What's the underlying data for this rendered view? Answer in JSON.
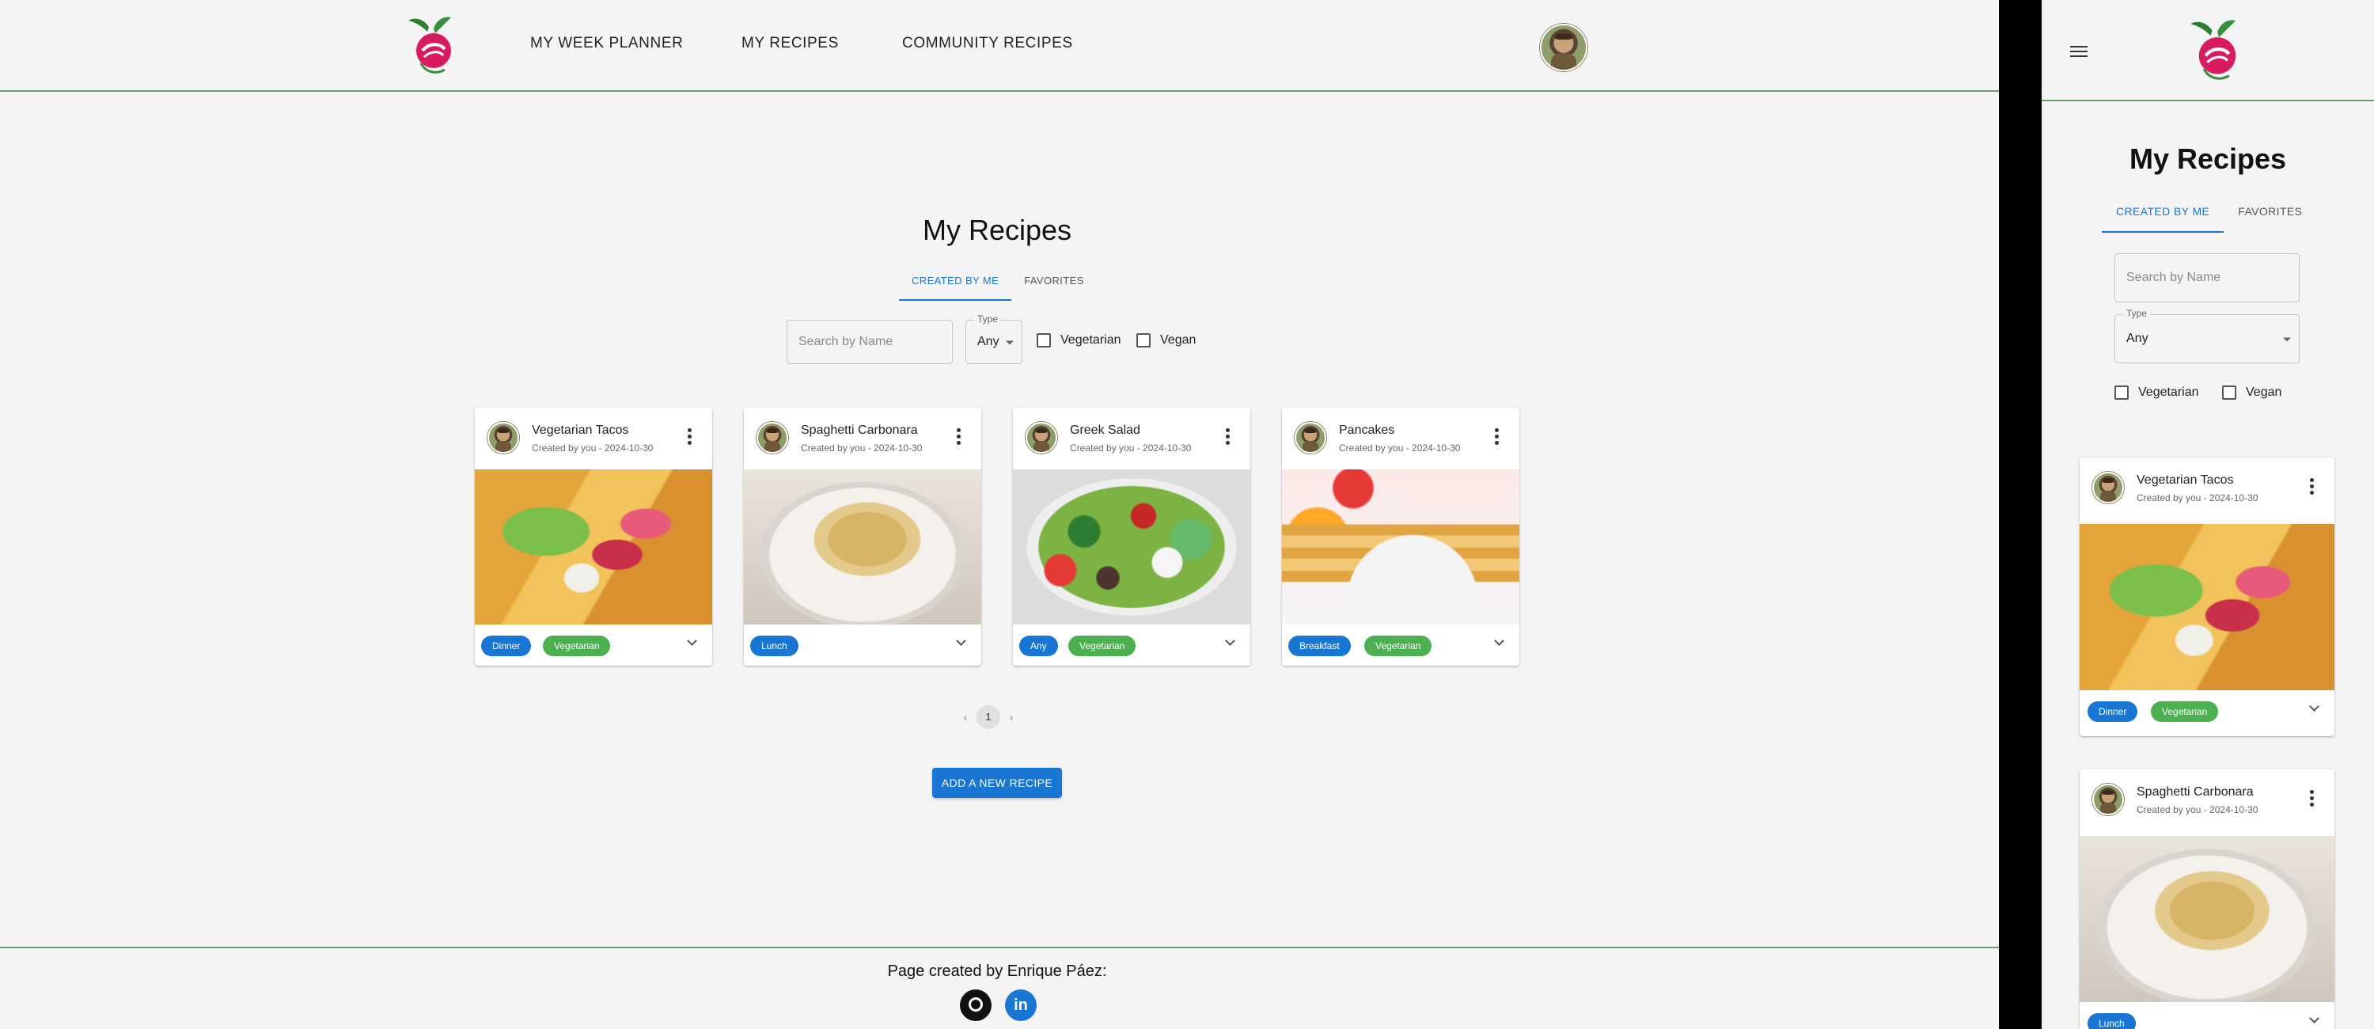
{
  "nav": {
    "items": [
      "MY WEEK PLANNER",
      "MY RECIPES",
      "COMMUNITY RECIPES"
    ]
  },
  "page": {
    "title": "My Recipes",
    "tabs": [
      "CREATED BY ME",
      "FAVORITES"
    ],
    "active_tab": "CREATED BY ME"
  },
  "filters": {
    "search_placeholder": "Search by Name",
    "type_label": "Type",
    "type_value": "Any",
    "checkboxes": [
      "Vegetarian",
      "Vegan"
    ]
  },
  "recipes": [
    {
      "title": "Vegetarian Tacos",
      "subtitle": "Created by you - 2024-10-30",
      "tags": [
        "Dinner",
        "Vegetarian"
      ]
    },
    {
      "title": "Spaghetti Carbonara",
      "subtitle": "Created by you - 2024-10-30",
      "tags": [
        "Lunch"
      ]
    },
    {
      "title": "Greek Salad",
      "subtitle": "Created by you - 2024-10-30",
      "tags": [
        "Any",
        "Vegetarian"
      ]
    },
    {
      "title": "Pancakes",
      "subtitle": "Created by you - 2024-10-30",
      "tags": [
        "Breakfast",
        "Vegetarian"
      ]
    }
  ],
  "pagination": {
    "current_page": "1",
    "prev": "‹",
    "next": "›"
  },
  "add_button": "ADD A NEW RECIPE",
  "footer": {
    "text": "Page created by Enrique Páez:",
    "linkedin_glyph": "in"
  },
  "icons": {
    "logo": "beet-logo-icon",
    "menu": "hamburger-menu-icon",
    "more": "kebab-more-icon",
    "expand": "chevron-down-icon",
    "github": "github-icon",
    "linkedin": "linkedin-icon"
  },
  "colors": {
    "accent": "#1976d2",
    "tag_green": "#4caf50",
    "divider_green": "#689f70",
    "background": "#f4f4f4"
  }
}
